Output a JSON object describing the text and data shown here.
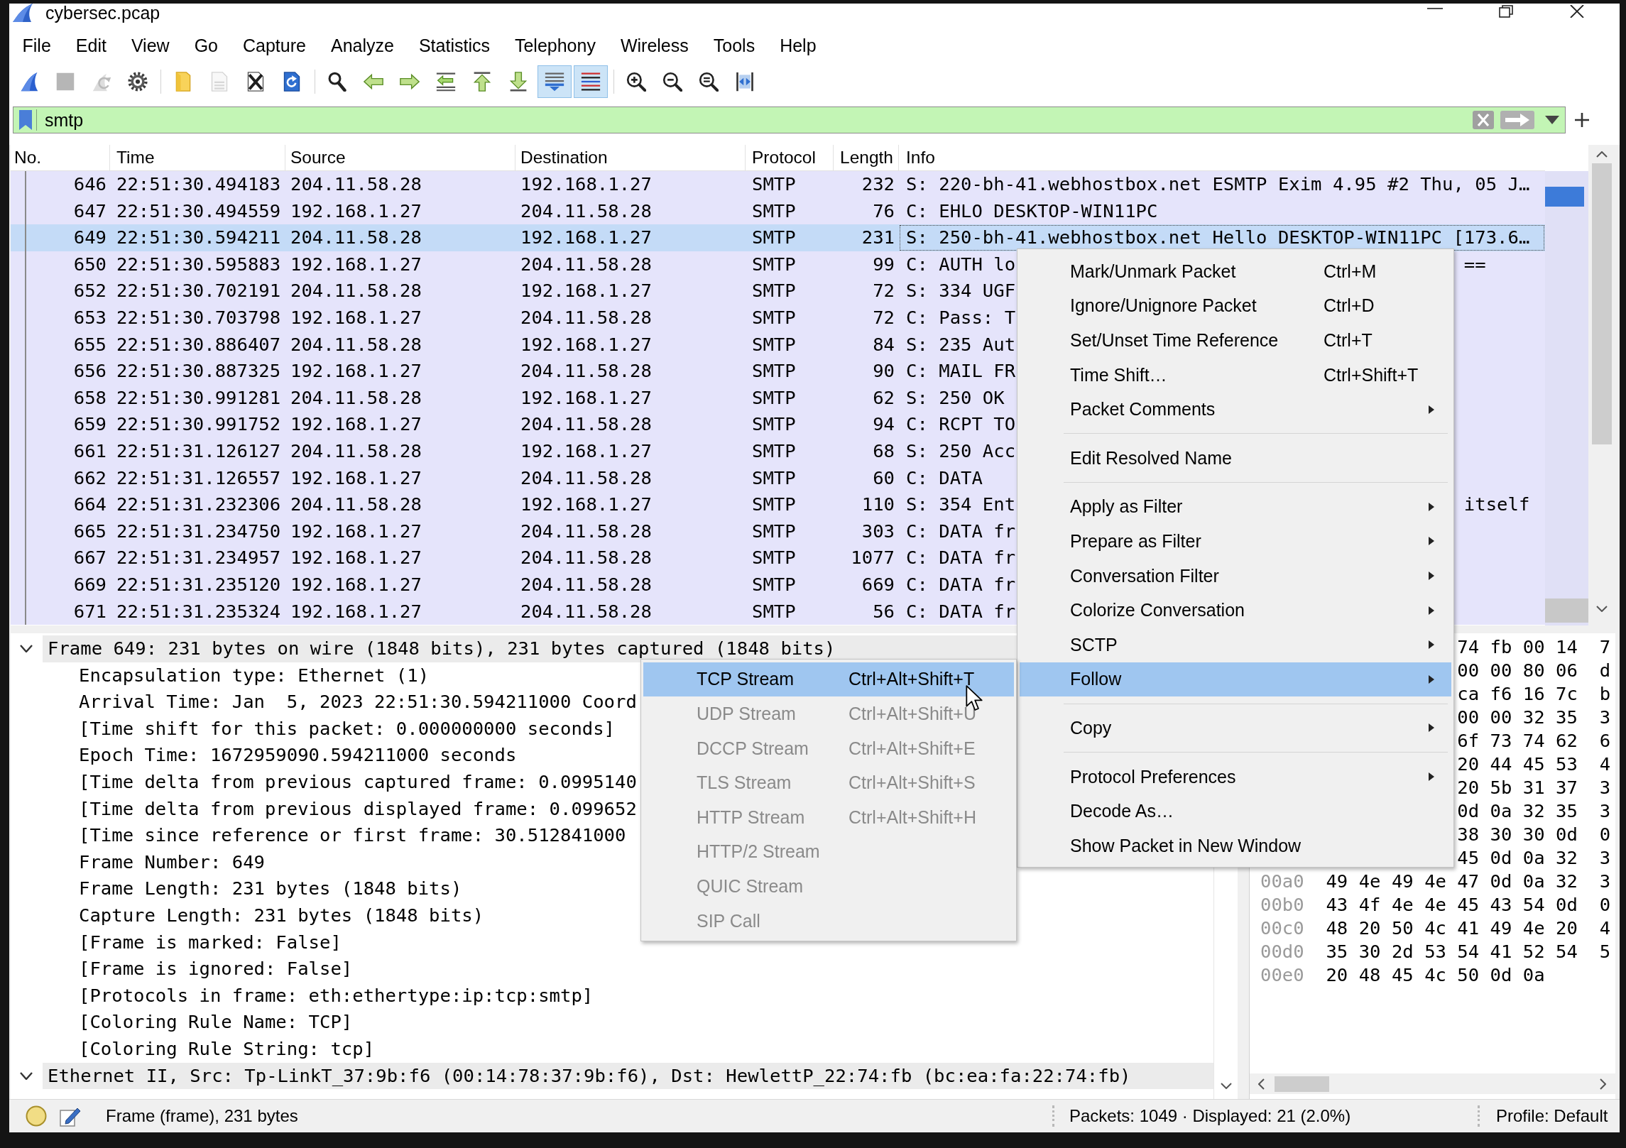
{
  "window": {
    "title": "cybersec.pcap"
  },
  "menu_bar": [
    "File",
    "Edit",
    "View",
    "Go",
    "Capture",
    "Analyze",
    "Statistics",
    "Telephony",
    "Wireless",
    "Tools",
    "Help"
  ],
  "toolbar": [
    {
      "kind": "start",
      "disabled": false,
      "checked": false
    },
    {
      "kind": "stop",
      "disabled": true,
      "checked": false
    },
    {
      "kind": "restart",
      "disabled": true,
      "checked": false
    },
    {
      "kind": "options",
      "disabled": false,
      "checked": false
    },
    {
      "kind": "separator"
    },
    {
      "kind": "open",
      "disabled": false,
      "checked": false
    },
    {
      "kind": "save",
      "disabled": true,
      "checked": false
    },
    {
      "kind": "close",
      "disabled": false,
      "checked": false
    },
    {
      "kind": "reload",
      "disabled": false,
      "checked": false
    },
    {
      "kind": "separator"
    },
    {
      "kind": "find",
      "disabled": false,
      "checked": false
    },
    {
      "kind": "back",
      "disabled": false,
      "checked": false
    },
    {
      "kind": "forward",
      "disabled": false,
      "checked": false
    },
    {
      "kind": "goto",
      "disabled": false,
      "checked": false
    },
    {
      "kind": "first",
      "disabled": false,
      "checked": false
    },
    {
      "kind": "last",
      "disabled": false,
      "checked": false
    },
    {
      "kind": "autoscroll",
      "disabled": false,
      "checked": true
    },
    {
      "kind": "colorize",
      "disabled": false,
      "checked": true
    },
    {
      "kind": "separator"
    },
    {
      "kind": "zoomin",
      "disabled": false,
      "checked": false
    },
    {
      "kind": "zoomout",
      "disabled": false,
      "checked": false
    },
    {
      "kind": "zoomreset",
      "disabled": false,
      "checked": false
    },
    {
      "kind": "resize",
      "disabled": false,
      "checked": false
    }
  ],
  "display_filter": {
    "value": "smtp",
    "valid": true
  },
  "packet_list": {
    "columns": [
      "No.",
      "Time",
      "Source",
      "Destination",
      "Protocol",
      "Length",
      "Info"
    ],
    "rows": [
      {
        "no": "646",
        "time": "22:51:30.494183",
        "source": "204.11.58.28",
        "destination": "192.168.1.27",
        "protocol": "SMTP",
        "length": "232",
        "info": "S: 220-bh-41.webhostbox.net ESMTP Exim 4.95 #2 Thu, 05 J…",
        "selected": false
      },
      {
        "no": "647",
        "time": "22:51:30.494559",
        "source": "192.168.1.27",
        "destination": "204.11.58.28",
        "protocol": "SMTP",
        "length": "76",
        "info": "C: EHLO DESKTOP-WIN11PC",
        "selected": false
      },
      {
        "no": "649",
        "time": "22:51:30.594211",
        "source": "204.11.58.28",
        "destination": "192.168.1.27",
        "protocol": "SMTP",
        "length": "231",
        "info": "S: 250-bh-41.webhostbox.net Hello DESKTOP-WIN11PC [173.6…",
        "selected": true
      },
      {
        "no": "650",
        "time": "22:51:30.595883",
        "source": "192.168.1.27",
        "destination": "204.11.58.28",
        "protocol": "SMTP",
        "length": "99",
        "info": "C: AUTH lo",
        "info_tail": "==",
        "selected": false
      },
      {
        "no": "652",
        "time": "22:51:30.702191",
        "source": "204.11.58.28",
        "destination": "192.168.1.27",
        "protocol": "SMTP",
        "length": "72",
        "info": "S: 334 UGF",
        "selected": false
      },
      {
        "no": "653",
        "time": "22:51:30.703798",
        "source": "192.168.1.27",
        "destination": "204.11.58.28",
        "protocol": "SMTP",
        "length": "72",
        "info": "C: Pass: T",
        "selected": false
      },
      {
        "no": "655",
        "time": "22:51:30.886407",
        "source": "204.11.58.28",
        "destination": "192.168.1.27",
        "protocol": "SMTP",
        "length": "84",
        "info": "S: 235 Aut",
        "selected": false
      },
      {
        "no": "656",
        "time": "22:51:30.887325",
        "source": "192.168.1.27",
        "destination": "204.11.58.28",
        "protocol": "SMTP",
        "length": "90",
        "info": "C: MAIL FR",
        "selected": false
      },
      {
        "no": "658",
        "time": "22:51:30.991281",
        "source": "204.11.58.28",
        "destination": "192.168.1.27",
        "protocol": "SMTP",
        "length": "62",
        "info": "S: 250 OK",
        "selected": false
      },
      {
        "no": "659",
        "time": "22:51:30.991752",
        "source": "192.168.1.27",
        "destination": "204.11.58.28",
        "protocol": "SMTP",
        "length": "94",
        "info": "C: RCPT TO",
        "selected": false
      },
      {
        "no": "661",
        "time": "22:51:31.126127",
        "source": "204.11.58.28",
        "destination": "192.168.1.27",
        "protocol": "SMTP",
        "length": "68",
        "info": "S: 250 Acc",
        "selected": false
      },
      {
        "no": "662",
        "time": "22:51:31.126557",
        "source": "192.168.1.27",
        "destination": "204.11.58.28",
        "protocol": "SMTP",
        "length": "60",
        "info": "C: DATA",
        "selected": false
      },
      {
        "no": "664",
        "time": "22:51:31.232306",
        "source": "204.11.58.28",
        "destination": "192.168.1.27",
        "protocol": "SMTP",
        "length": "110",
        "info": "S: 354 Ent",
        "info_tail": "itself",
        "selected": false
      },
      {
        "no": "665",
        "time": "22:51:31.234750",
        "source": "192.168.1.27",
        "destination": "204.11.58.28",
        "protocol": "SMTP",
        "length": "303",
        "info": "C: DATA fr",
        "selected": false
      },
      {
        "no": "667",
        "time": "22:51:31.234957",
        "source": "192.168.1.27",
        "destination": "204.11.58.28",
        "protocol": "SMTP",
        "length": "1077",
        "info": "C: DATA fr",
        "selected": false
      },
      {
        "no": "669",
        "time": "22:51:31.235120",
        "source": "192.168.1.27",
        "destination": "204.11.58.28",
        "protocol": "SMTP",
        "length": "669",
        "info": "C: DATA fr",
        "selected": false
      },
      {
        "no": "671",
        "time": "22:51:31.235324",
        "source": "192.168.1.27",
        "destination": "204.11.58.28",
        "protocol": "SMTP",
        "length": "56",
        "info": "C: DATA fr",
        "selected": false
      }
    ]
  },
  "packet_details": [
    {
      "text": "Frame 649: 231 bytes on wire (1848 bits), 231 bytes captured (1848 bits)",
      "expanded": true,
      "children": [
        {
          "text": "Encapsulation type: Ethernet (1)"
        },
        {
          "text": "Arrival Time: Jan  5, 2023 22:51:30.594211000 Coord"
        },
        {
          "text": "[Time shift for this packet: 0.000000000 seconds]"
        },
        {
          "text": "Epoch Time: 1672959090.594211000 seconds"
        },
        {
          "text": "[Time delta from previous captured frame: 0.0995140"
        },
        {
          "text": "[Time delta from previous displayed frame: 0.099652"
        },
        {
          "text": "[Time since reference or first frame: 30.512841000"
        },
        {
          "text": "Frame Number: 649"
        },
        {
          "text": "Frame Length: 231 bytes (1848 bits)"
        },
        {
          "text": "Capture Length: 231 bytes (1848 bits)"
        },
        {
          "text": "[Frame is marked: False]"
        },
        {
          "text": "[Frame is ignored: False]"
        },
        {
          "text": "[Protocols in frame: eth:ethertype:ip:tcp:smtp]"
        },
        {
          "text": "[Coloring Rule Name: TCP]"
        },
        {
          "text": "[Coloring Rule String: tcp]"
        }
      ]
    },
    {
      "text": "Ethernet II, Src: Tp-LinkT_37:9b:f6 (00:14:78:37:9b:f6), Dst: HewlettP_22:74:fb (bc:ea:fa:22:74:fb)",
      "expanded": true
    }
  ],
  "packet_bytes": [
    {
      "bytes": "74 fb 00 14  7"
    },
    {
      "bytes": "00 00 80 06  d"
    },
    {
      "bytes": "ca f6 16 7c  b"
    },
    {
      "bytes": "00 00 32 35  3"
    },
    {
      "bytes": "6f 73 74 62  6"
    },
    {
      "bytes": "20 44 45 53  4"
    },
    {
      "bytes": "20 5b 31 37  3"
    },
    {
      "bytes": "0d 0a 32 35  3"
    },
    {
      "bytes": "38 30 30 0d  0"
    },
    {
      "bytes": "45 0d 0a 32  3"
    },
    {
      "offset": "00a0",
      "bytes": "49 4e 49 4e 47 0d 0a 32  3"
    },
    {
      "offset": "00b0",
      "bytes": "43 4f 4e 4e 45 43 54 0d  0"
    },
    {
      "offset": "00c0",
      "bytes": "48 20 50 4c 41 49 4e 20  4"
    },
    {
      "offset": "00d0",
      "bytes": "35 30 2d 53 54 41 52 54  5"
    },
    {
      "offset": "00e0",
      "bytes": "20 48 45 4c 50 0d 0a"
    }
  ],
  "context_menu": {
    "items": [
      {
        "kind": "item",
        "label": "Mark/Unmark Packet",
        "shortcut": "Ctrl+M",
        "submenu": false,
        "selected": false
      },
      {
        "kind": "item",
        "label": "Ignore/Unignore Packet",
        "shortcut": "Ctrl+D",
        "submenu": false,
        "selected": false
      },
      {
        "kind": "item",
        "label": "Set/Unset Time Reference",
        "shortcut": "Ctrl+T",
        "submenu": false,
        "selected": false
      },
      {
        "kind": "item",
        "label": "Time Shift…",
        "shortcut": "Ctrl+Shift+T",
        "submenu": false,
        "selected": false
      },
      {
        "kind": "item",
        "label": "Packet Comments",
        "submenu": true,
        "selected": false
      },
      {
        "kind": "separator"
      },
      {
        "kind": "item",
        "label": "Edit Resolved Name",
        "submenu": false,
        "selected": false
      },
      {
        "kind": "separator"
      },
      {
        "kind": "item",
        "label": "Apply as Filter",
        "submenu": true,
        "selected": false
      },
      {
        "kind": "item",
        "label": "Prepare as Filter",
        "submenu": true,
        "selected": false
      },
      {
        "kind": "item",
        "label": "Conversation Filter",
        "submenu": true,
        "selected": false
      },
      {
        "kind": "item",
        "label": "Colorize Conversation",
        "submenu": true,
        "selected": false
      },
      {
        "kind": "item",
        "label": "SCTP",
        "submenu": true,
        "selected": false
      },
      {
        "kind": "item",
        "label": "Follow",
        "submenu": true,
        "selected": true,
        "submenu_items": [
          {
            "label": "TCP Stream",
            "shortcut": "Ctrl+Alt+Shift+T",
            "disabled": false,
            "selected": true
          },
          {
            "label": "UDP Stream",
            "shortcut": "Ctrl+Alt+Shift+U",
            "disabled": true,
            "selected": false
          },
          {
            "label": "DCCP Stream",
            "shortcut": "Ctrl+Alt+Shift+E",
            "disabled": true,
            "selected": false
          },
          {
            "label": "TLS Stream",
            "shortcut": "Ctrl+Alt+Shift+S",
            "disabled": true,
            "selected": false
          },
          {
            "label": "HTTP Stream",
            "shortcut": "Ctrl+Alt+Shift+H",
            "disabled": true,
            "selected": false
          },
          {
            "label": "HTTP/2 Stream",
            "disabled": true,
            "selected": false
          },
          {
            "label": "QUIC Stream",
            "disabled": true,
            "selected": false
          },
          {
            "label": "SIP Call",
            "disabled": true,
            "selected": false
          }
        ]
      },
      {
        "kind": "separator"
      },
      {
        "kind": "item",
        "label": "Copy",
        "submenu": true,
        "selected": false
      },
      {
        "kind": "separator"
      },
      {
        "kind": "item",
        "label": "Protocol Preferences",
        "submenu": true,
        "selected": false
      },
      {
        "kind": "item",
        "label": "Decode As…",
        "submenu": false,
        "selected": false
      },
      {
        "kind": "item",
        "label": "Show Packet in New Window",
        "submenu": false,
        "selected": false
      }
    ]
  },
  "status_bar": {
    "selection": "Frame (frame), 231 bytes",
    "packets": "Packets: 1049 · Displayed: 21 (2.0%)",
    "profile": "Profile: Default"
  }
}
